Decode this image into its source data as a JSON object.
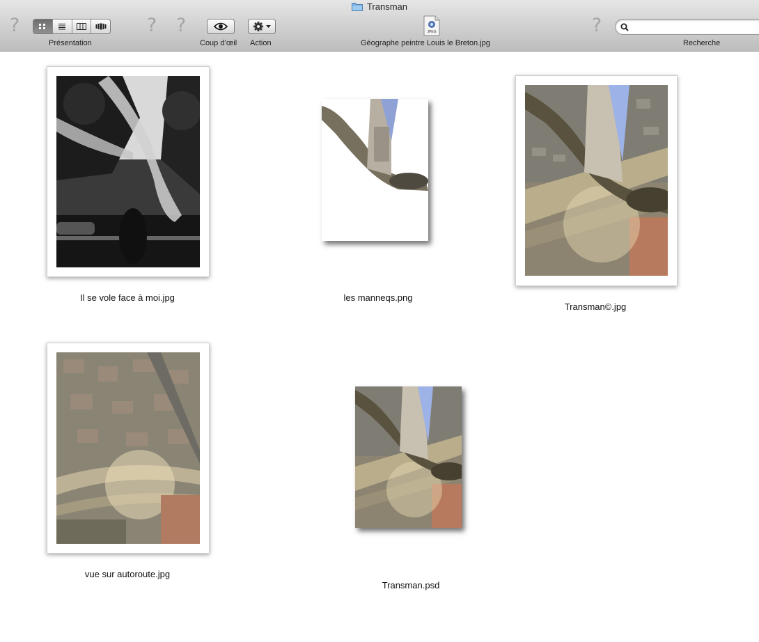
{
  "window": {
    "title": "Transman"
  },
  "toolbar": {
    "presentation_label": "Présentation",
    "coup_doeil_label": "Coup d’œil",
    "action_label": "Action",
    "selected_file_label": "Géographe peintre Louis le Breton.jpg",
    "selected_file_icon_text": "JPEG",
    "search_label": "Recherche",
    "search_value": ""
  },
  "files": [
    {
      "name": "Il se vole face à moi.jpg"
    },
    {
      "name": "les manneqs.png"
    },
    {
      "name": "Transman©.jpg"
    },
    {
      "name": "vue sur autoroute.jpg"
    },
    {
      "name": "Transman.psd"
    }
  ]
}
